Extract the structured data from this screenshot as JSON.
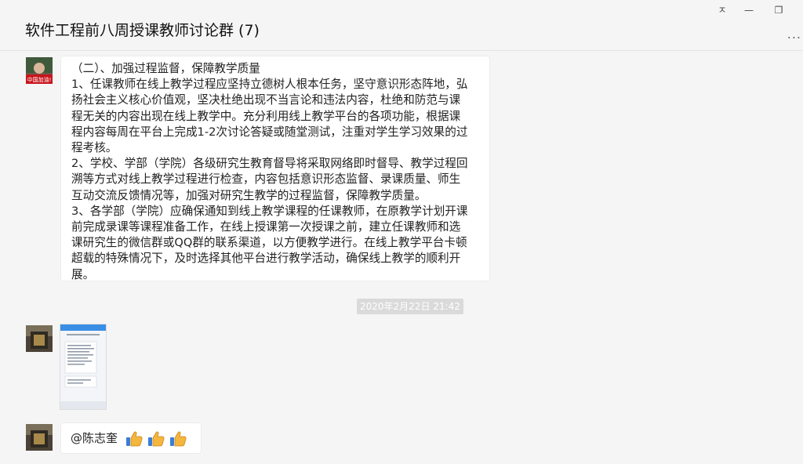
{
  "window": {
    "title": "软件工程前八周授课教师讨论群 (7)",
    "pin_symbol": "ㅈ",
    "minimize_symbol": "—",
    "restore_symbol": "❐",
    "more_symbol": "..."
  },
  "messages": {
    "first": {
      "avatar_caption": "中国加油!",
      "lines": [
        "   （二）、加强过程监督，保障教学质量",
        "1、任课教师在线上教学过程应坚持立德树人根本任务，坚守意识形态阵地，弘",
        "扬社会主义核心价值观，坚决杜绝出现不当言论和违法内容，杜绝和防范与课",
        "程无关的内容出现在线上教学中。充分利用线上教学平台的各项功能，根据课",
        "程内容每周在平台上完成1-2次讨论答疑或随堂测试，注重对学生学习效果的过",
        "程考核。",
        "2、学校、学部（学院）各级研究生教育督导将采取网络即时督导、教学过程回",
        "溯等方式对线上教学过程进行检查，内容包括意识形态监督、录课质量、师生",
        "互动交流反馈情况等，加强对研究生教学的过程监督，保障教学质量。",
        "3、各学部（学院）应确保通知到线上教学课程的任课教师，在原教学计划开课",
        "前完成录课等课程准备工作，在线上授课第一次授课之前，建立任课教师和选",
        "课研究生的微信群或QQ群的联系渠道，以方便教学进行。在线上教学平台卡顿",
        "超载的特殊情况下，及时选择其他平台进行教学活动，确保线上教学的顺利开",
        "展。"
      ]
    },
    "timestamp": "2020年2月22日 21:42",
    "at_message": {
      "mention": "@陈志奎",
      "emoji": "thumbs-up",
      "emoji_count": 3
    }
  },
  "colors": {
    "background": "#f5f5f5",
    "bubble": "#ffffff",
    "timestamp_bg": "#dadada",
    "thumb": "#f4b63c"
  }
}
